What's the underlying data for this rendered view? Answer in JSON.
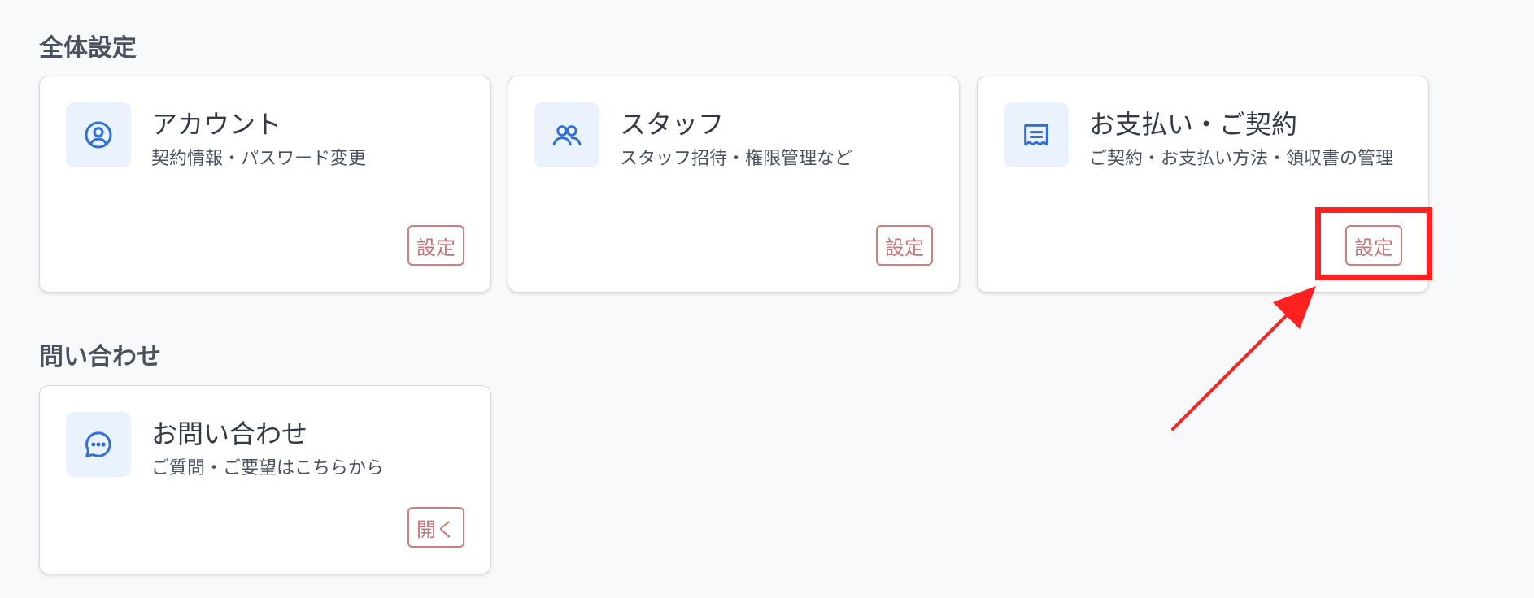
{
  "sections": {
    "general": {
      "title": "全体設定",
      "cards": [
        {
          "title": "アカウント",
          "desc": "契約情報・パスワード変更",
          "button": "設定",
          "icon": "user-circle-icon"
        },
        {
          "title": "スタッフ",
          "desc": "スタッフ招待・権限管理など",
          "button": "設定",
          "icon": "users-icon"
        },
        {
          "title": "お支払い・ご契約",
          "desc": "ご契約・お支払い方法・領収書の管理",
          "button": "設定",
          "icon": "receipt-icon"
        }
      ]
    },
    "contact": {
      "title": "問い合わせ",
      "cards": [
        {
          "title": "お問い合わせ",
          "desc": "ご質問・ご要望はこちらから",
          "button": "開く",
          "icon": "chat-icon"
        }
      ]
    }
  },
  "colors": {
    "accent_icon": "#2f6fd6",
    "icon_bg": "#eaf2fe",
    "button_border": "#cd7f80",
    "annotation": "#ff2020"
  }
}
